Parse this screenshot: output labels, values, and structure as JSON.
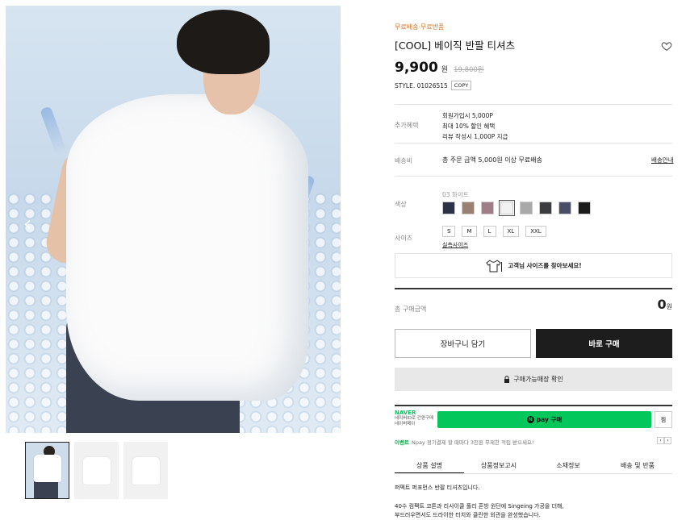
{
  "gallery": {
    "prev_glyph": "‹",
    "thumbnails": [
      "model",
      "front",
      "back"
    ]
  },
  "product": {
    "shipping_tag": "무료배송·무료반품",
    "title": "[COOL] 베이직 반팔 티셔츠",
    "price": "9,900",
    "price_unit": "원",
    "original_price": "19,800원",
    "style_code": "STYLE. 01026515",
    "copy_label": "COPY"
  },
  "benefits": {
    "label": "추가혜택",
    "lines": [
      "회원가입시 5,000P",
      "최대 10% 할인 혜택",
      "리뷰 작성시 1,000P 지급"
    ]
  },
  "shipping": {
    "label": "배송비",
    "text": "총 주문 금액 5,000원 이상 무료배송",
    "link": "배송안내"
  },
  "color": {
    "label": "색상",
    "selected_name": "03 화이트",
    "swatches": [
      "#2c3245",
      "#9a8070",
      "#a07e88",
      "#f2f2f2",
      "#a9a9a9",
      "#3a3c40",
      "#4a4e66",
      "#1c1c1c"
    ],
    "selected_index": 3
  },
  "size": {
    "label": "사이즈",
    "options": [
      "S",
      "M",
      "L",
      "XL",
      "XXL"
    ],
    "guide": "실측사이즈"
  },
  "find_size": "고객님 사이즈를 찾아보세요!",
  "total": {
    "label": "총 구매금액",
    "value": "0",
    "unit": "원"
  },
  "buttons": {
    "cart": "장바구니 담기",
    "buy": "바로 구매",
    "store": "구매가능매장 확인"
  },
  "npay": {
    "brand": "NAVER",
    "sub1": "네이버ID로 간편구매",
    "sub2": "네이버페이",
    "button": "pay 구매",
    "zzim": "찜",
    "event_tag": "이벤트",
    "event_text": "Npay 정기결제 할 때마다 3천원 무제한 적립 받으세요!"
  },
  "tabs": [
    "상품 설명",
    "상품정보고시",
    "소재정보",
    "배송 및 반품"
  ],
  "description": {
    "line1": "퍼펙트 퍼포먼스 반팔 티셔츠입니다.",
    "line2": "40수 컴팩트 코튼과 리사이클 폴리 혼방 원단에 Singeing 가공을 더해,",
    "line3": "부드러우면서도 드라이한 터치와 클린한 외관을 완성했습니다."
  }
}
